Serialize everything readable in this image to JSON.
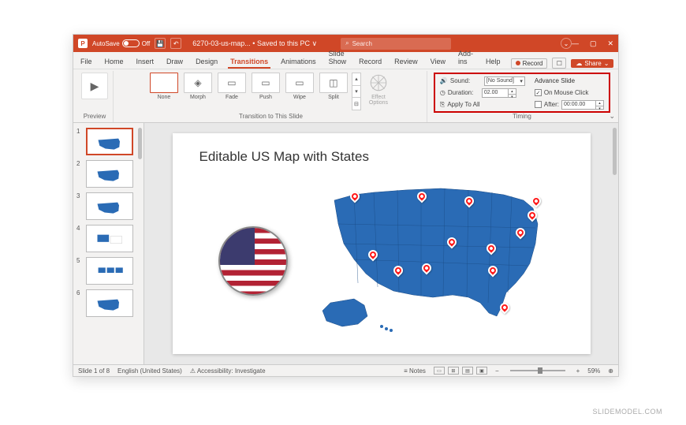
{
  "titlebar": {
    "autosave_label": "AutoSave",
    "autosave_state": "Off",
    "doc_name": "6270-03-us-map...",
    "saved_status": "Saved to this PC ",
    "search_placeholder": "Search"
  },
  "tabs": {
    "items": [
      "File",
      "Home",
      "Insert",
      "Draw",
      "Design",
      "Transitions",
      "Animations",
      "Slide Show",
      "Record",
      "Review",
      "View",
      "Add-ins",
      "Help"
    ],
    "active": "Transitions",
    "record_label": "Record",
    "share_label": "Share"
  },
  "ribbon": {
    "preview_label": "Preview",
    "gallery_items": [
      {
        "label": "None",
        "icon": ""
      },
      {
        "label": "Morph",
        "icon": "◈"
      },
      {
        "label": "Fade",
        "icon": "▭"
      },
      {
        "label": "Push",
        "icon": "▭"
      },
      {
        "label": "Wipe",
        "icon": "▭"
      },
      {
        "label": "Split",
        "icon": "◫"
      }
    ],
    "gallery_active": "None",
    "gallery_group_label": "Transition to This Slide",
    "effect_options_label": "Effect Options",
    "timing": {
      "sound_label": "Sound:",
      "sound_value": "[No Sound]",
      "duration_label": "Duration:",
      "duration_value": "02.00",
      "apply_all_label": "Apply To All",
      "advance_label": "Advance Slide",
      "on_click_label": "On Mouse Click",
      "on_click_checked": true,
      "after_label": "After:",
      "after_checked": false,
      "after_value": "00:00.00",
      "group_label": "Timing"
    }
  },
  "thumbnails": {
    "count": 6,
    "active": 1
  },
  "slide": {
    "title": "Editable US Map with States"
  },
  "statusbar": {
    "slide_info": "Slide 1 of 8",
    "language": "English (United States)",
    "accessibility": "Accessibility: Investigate",
    "notes_label": "Notes",
    "zoom": "59%"
  },
  "watermark": "SLIDEMODEL.COM"
}
